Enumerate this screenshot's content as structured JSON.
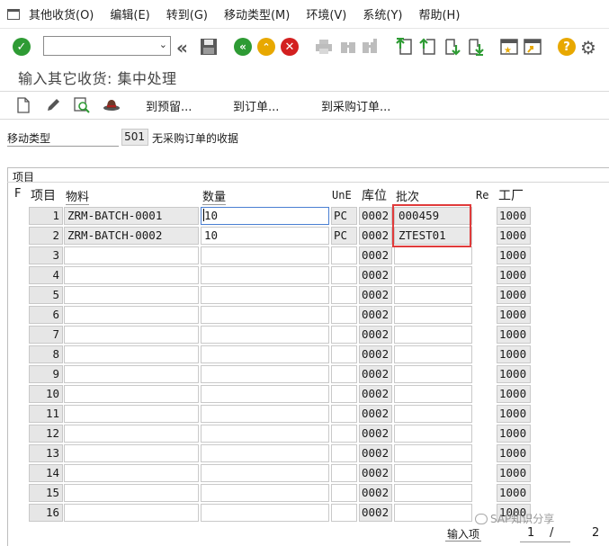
{
  "menu": {
    "items": [
      "其他收货(O)",
      "编辑(E)",
      "转到(G)",
      "移动类型(M)",
      "环境(V)",
      "系统(Y)",
      "帮助(H)"
    ]
  },
  "toolbar": {
    "icons": [
      "enter-check-icon",
      "command-field",
      "collapse-icon",
      "save-icon",
      "back-icon",
      "exit-icon",
      "cancel-icon",
      "print-icon",
      "find-icon",
      "find-next-icon",
      "first-page-icon",
      "prev-page-icon",
      "next-page-icon",
      "last-page-icon",
      "create-session-icon",
      "shortcut-icon",
      "help-icon",
      "settings-icon"
    ],
    "colors": {
      "green": "#2e9b34",
      "yellow": "#e8a800",
      "red": "#d32020"
    }
  },
  "page_title": "输入其它收货: 集中处理",
  "app_toolbar": {
    "btn_reserve": "到预留...",
    "btn_order": "到订单...",
    "btn_po": "到采购订单..."
  },
  "movement": {
    "label": "移动类型",
    "value": "501",
    "description": "无采购订单的收据"
  },
  "section": {
    "title": "项目"
  },
  "table": {
    "headers": {
      "f": "F",
      "item": "项目",
      "material": "物料",
      "quantity": "数量",
      "une": "UnE",
      "sloc": "库位",
      "batch": "批次",
      "re": "Re",
      "plant": "工厂"
    },
    "rows": [
      {
        "item": "1",
        "material": "ZRM-BATCH-0001",
        "quantity": "10",
        "une": "PC",
        "sloc": "0002",
        "batch": "000459",
        "plant": "1000"
      },
      {
        "item": "2",
        "material": "ZRM-BATCH-0002",
        "quantity": "10",
        "une": "PC",
        "sloc": "0002",
        "batch": "ZTEST01",
        "plant": "1000"
      },
      {
        "item": "3",
        "material": "",
        "quantity": "",
        "une": "",
        "sloc": "0002",
        "batch": "",
        "plant": "1000"
      },
      {
        "item": "4",
        "material": "",
        "quantity": "",
        "une": "",
        "sloc": "0002",
        "batch": "",
        "plant": "1000"
      },
      {
        "item": "5",
        "material": "",
        "quantity": "",
        "une": "",
        "sloc": "0002",
        "batch": "",
        "plant": "1000"
      },
      {
        "item": "6",
        "material": "",
        "quantity": "",
        "une": "",
        "sloc": "0002",
        "batch": "",
        "plant": "1000"
      },
      {
        "item": "7",
        "material": "",
        "quantity": "",
        "une": "",
        "sloc": "0002",
        "batch": "",
        "plant": "1000"
      },
      {
        "item": "8",
        "material": "",
        "quantity": "",
        "une": "",
        "sloc": "0002",
        "batch": "",
        "plant": "1000"
      },
      {
        "item": "9",
        "material": "",
        "quantity": "",
        "une": "",
        "sloc": "0002",
        "batch": "",
        "plant": "1000"
      },
      {
        "item": "10",
        "material": "",
        "quantity": "",
        "une": "",
        "sloc": "0002",
        "batch": "",
        "plant": "1000"
      },
      {
        "item": "11",
        "material": "",
        "quantity": "",
        "une": "",
        "sloc": "0002",
        "batch": "",
        "plant": "1000"
      },
      {
        "item": "12",
        "material": "",
        "quantity": "",
        "une": "",
        "sloc": "0002",
        "batch": "",
        "plant": "1000"
      },
      {
        "item": "13",
        "material": "",
        "quantity": "",
        "une": "",
        "sloc": "0002",
        "batch": "",
        "plant": "1000"
      },
      {
        "item": "14",
        "material": "",
        "quantity": "",
        "une": "",
        "sloc": "0002",
        "batch": "",
        "plant": "1000"
      },
      {
        "item": "15",
        "material": "",
        "quantity": "",
        "une": "",
        "sloc": "0002",
        "batch": "",
        "plant": "1000"
      },
      {
        "item": "16",
        "material": "",
        "quantity": "",
        "une": "",
        "sloc": "0002",
        "batch": "",
        "plant": "1000"
      }
    ]
  },
  "footer": {
    "label": "输入项",
    "current": "1",
    "separator": "/",
    "total": "2"
  },
  "watermark": "SAP知识分享",
  "highlight_color": "#e03b3b"
}
